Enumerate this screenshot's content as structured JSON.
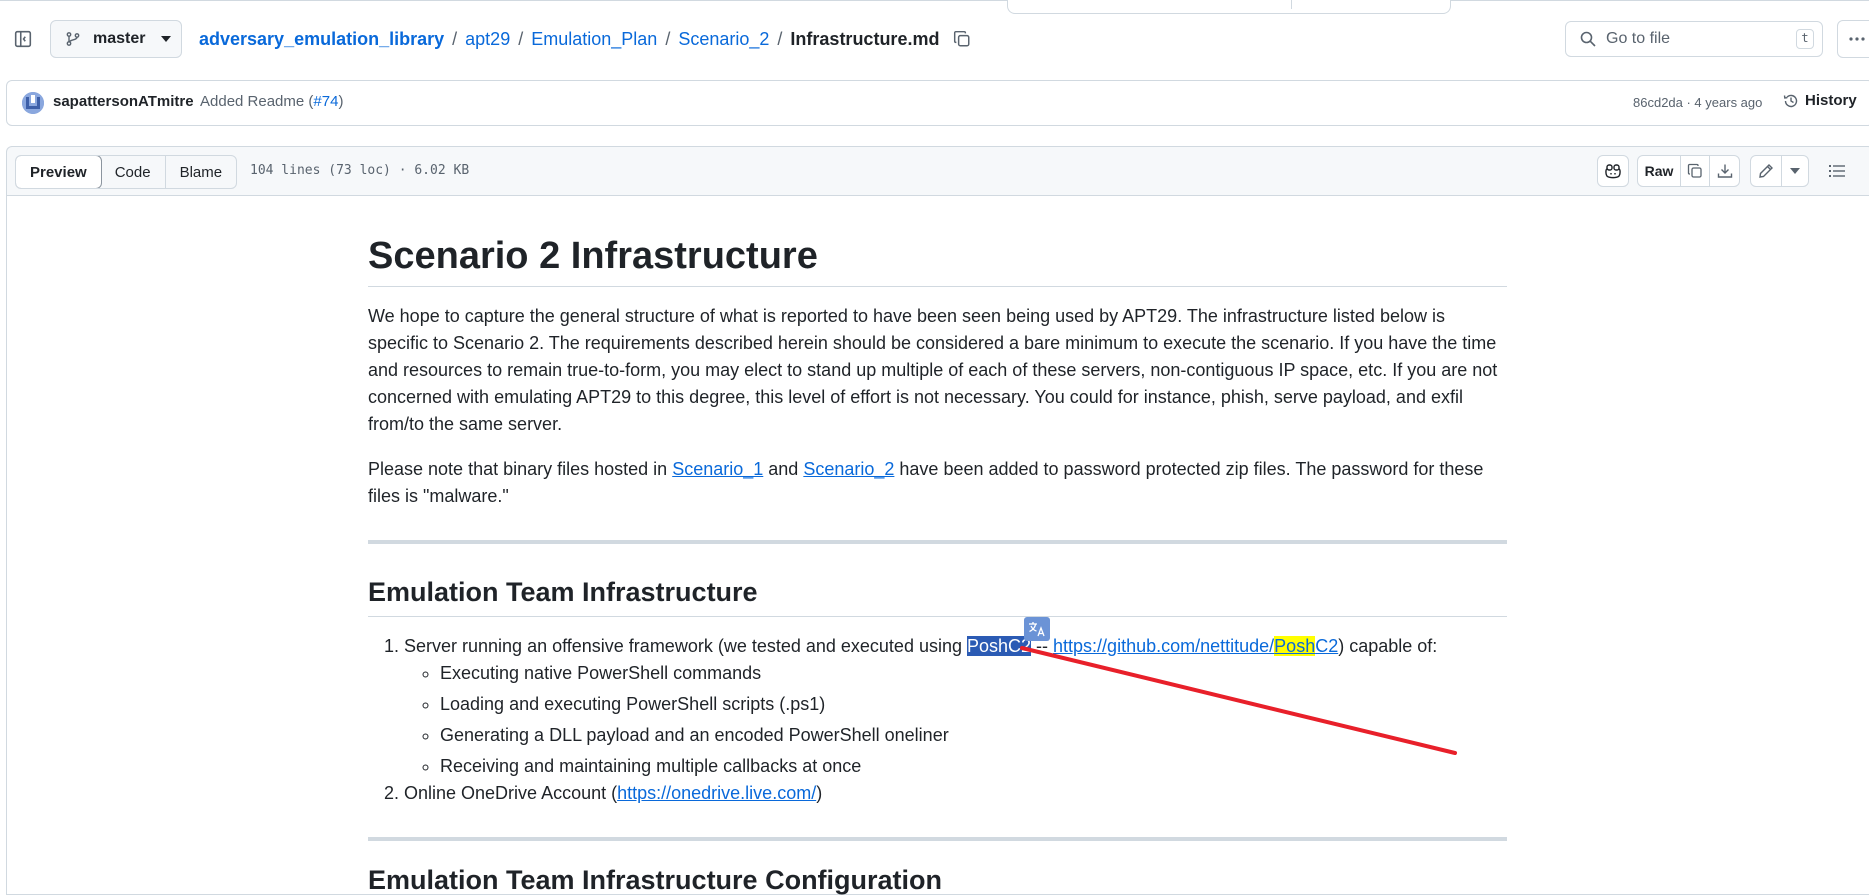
{
  "header": {
    "branch": "master",
    "breadcrumb": {
      "repo": "adversary_emulation_library",
      "parts": [
        "apt29",
        "Emulation_Plan",
        "Scenario_2"
      ],
      "file": "Infrastructure.md",
      "separator": "/"
    },
    "search": {
      "placeholder": "Go to file",
      "shortcut": "t"
    }
  },
  "commit": {
    "author": "sapattersonATmitre",
    "message_prefix": "Added Readme (",
    "pr_link": "#74",
    "message_suffix": ")",
    "meta": "86cd2da · 4 years ago",
    "history_label": "History"
  },
  "file_toolbar": {
    "tabs": [
      "Preview",
      "Code",
      "Blame"
    ],
    "active_tab": "Preview",
    "info": "104 lines (73 loc) · 6.02 KB",
    "raw_label": "Raw"
  },
  "content": {
    "title": "Scenario 2 Infrastructure",
    "intro": "We hope to capture the general structure of what is reported to have been seen being used by APT29. The infrastructure listed below is specific to Scenario 2. The requirements described herein should be considered a bare minimum to execute the scenario. If you have the time and resources to remain true-to-form, you may elect to stand up multiple of each of these servers, non-contiguous IP space, etc. If you are not concerned with emulating APT29 to this degree, this level of effort is not necessary. You could for instance, phish, serve payload, and exfil from/to the same server.",
    "note_prefix": "Please note that binary files hosted in ",
    "note_link1": "Scenario_1",
    "note_and": " and ",
    "note_link2": "Scenario_2",
    "note_suffix": " have been added to password protected zip files. The password for these files is \"malware.\"",
    "section_title": "Emulation Team Infrastructure",
    "item1_prefix": "Server running an offensive framework (we tested and executed using ",
    "item1_selected": "PoshC2",
    "item1_dash": " -- ",
    "item1_link_a": "https://github.com/nettitude/",
    "item1_link_hi": "Posh",
    "item1_link_b": "C2",
    "item1_suffix": ") capable of:",
    "subitems": [
      "Executing native PowerShell commands",
      "Loading and executing PowerShell scripts (.ps1)",
      "Generating a DLL payload and an encoded PowerShell oneliner",
      "Receiving and maintaining multiple callbacks at once"
    ],
    "item2_prefix": "Online OneDrive Account (",
    "item2_link": "https://onedrive.live.com/",
    "item2_suffix": ")",
    "next_section_title": "Emulation Team Infrastructure Configuration"
  },
  "annotation": {
    "arrow_color": "#e8202a"
  },
  "colors": {
    "link": "#0969da",
    "selection": "#2b5bb4",
    "highlight": "#ffff00"
  }
}
